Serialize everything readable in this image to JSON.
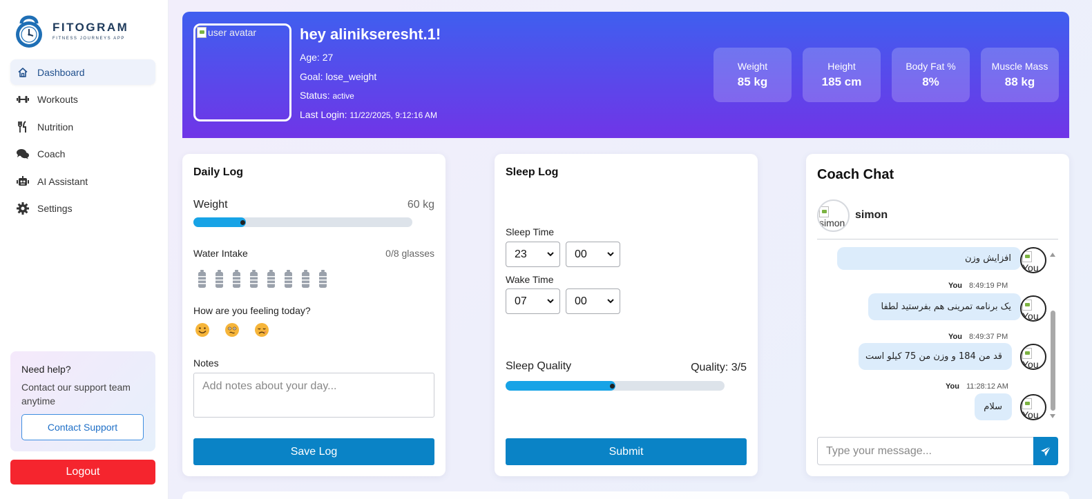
{
  "brand": {
    "name": "FITOGRAM",
    "tagline": "FITNESS JOURNEYS APP"
  },
  "nav": [
    {
      "label": "Dashboard",
      "icon": "home-icon",
      "active": true
    },
    {
      "label": "Workouts",
      "icon": "dumbbell-icon",
      "active": false
    },
    {
      "label": "Nutrition",
      "icon": "utensils-icon",
      "active": false
    },
    {
      "label": "Coach",
      "icon": "chat-bubbles-icon",
      "active": false
    },
    {
      "label": "AI Assistant",
      "icon": "robot-icon",
      "active": false
    },
    {
      "label": "Settings",
      "icon": "gear-icon",
      "active": false
    }
  ],
  "help": {
    "title": "Need help?",
    "text": "Contact our support team anytime",
    "button": "Contact Support"
  },
  "logout": "Logout",
  "profile": {
    "avatar_alt": "user avatar",
    "greeting": "hey alinikseresht.1!",
    "age_label": "Age:",
    "age": "27",
    "goal_label": "Goal:",
    "goal": "lose_weight",
    "status_label": "Status:",
    "status": "active",
    "last_login_label": "Last Login:",
    "last_login": "11/22/2025, 9:12:16 AM"
  },
  "stats": [
    {
      "label": "Weight",
      "value": "85 kg"
    },
    {
      "label": "Height",
      "value": "185 cm"
    },
    {
      "label": "Body Fat %",
      "value": "8%"
    },
    {
      "label": "Muscle Mass",
      "value": "88 kg"
    }
  ],
  "daily_log": {
    "title": "Daily Log",
    "weight_label": "Weight",
    "weight_value": "60 kg",
    "weight_level": 0.24,
    "water_label": "Water Intake",
    "water_value": "0/8 glasses",
    "water_total": 8,
    "mood_question": "How are you feeling today?",
    "moods": [
      "happy-face-icon",
      "neutral-face-icon",
      "sad-face-icon"
    ],
    "notes_label": "Notes",
    "notes_placeholder": "Add notes about your day...",
    "save_button": "Save Log"
  },
  "sleep_log": {
    "title": "Sleep Log",
    "sleep_time_label": "Sleep Time",
    "sleep_hour": "23",
    "sleep_minute": "00",
    "wake_time_label": "Wake Time",
    "wake_hour": "07",
    "wake_minute": "00",
    "quality_label": "Sleep Quality",
    "quality_text": "Quality: 3/5",
    "quality_level": 0.5,
    "submit_button": "Submit"
  },
  "chat": {
    "title": "Coach Chat",
    "coach_name": "simon",
    "coach_avatar_alt": "simon",
    "messages": [
      {
        "sender": "",
        "time": "",
        "text": "افزایش وزن",
        "avatar_alt": "You"
      },
      {
        "sender": "You",
        "time": "8:49:19 PM",
        "text": "یک برنامه تمرینی هم بفرستید لطفا",
        "avatar_alt": "You"
      },
      {
        "sender": "You",
        "time": "8:49:37 PM",
        "text": "قد من 184 و وزن من 75 کیلو است",
        "avatar_alt": "You"
      },
      {
        "sender": "You",
        "time": "11:28:12 AM",
        "text": "سلام",
        "avatar_alt": "You"
      }
    ],
    "input_placeholder": "Type your message..."
  },
  "colors": {
    "header_top": "#3f5fef",
    "header_bottom": "#7035e7",
    "accent": "#0a83c6",
    "slider": "#17a3e6",
    "logout": "#f5252e"
  }
}
